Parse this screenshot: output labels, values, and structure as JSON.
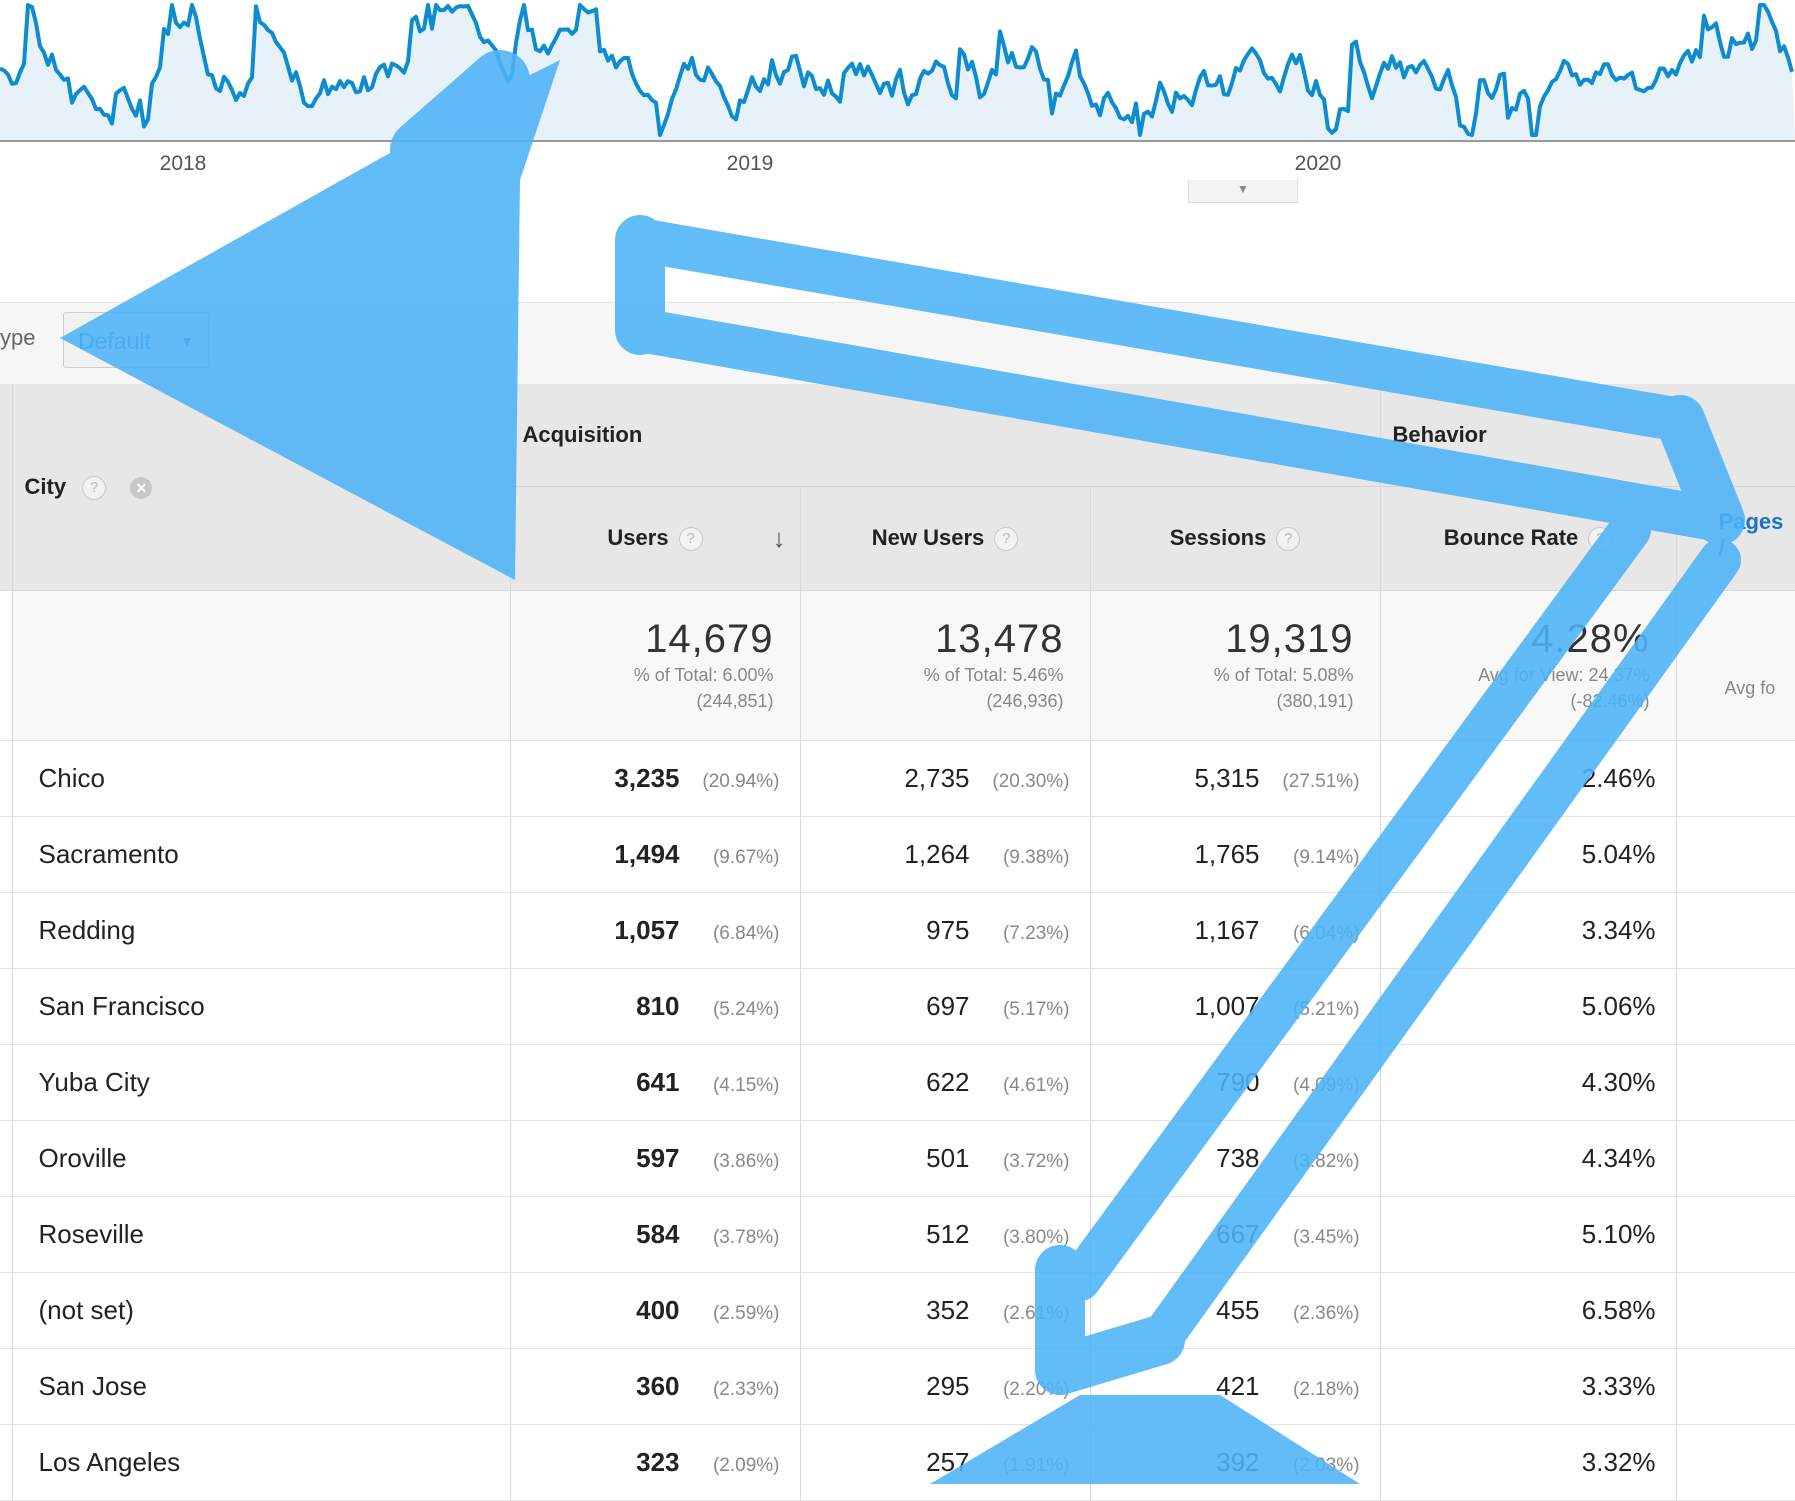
{
  "timeline": {
    "years": [
      "2018",
      "2019",
      "2020"
    ],
    "line_color": "#0d8ccf",
    "fill_color": "#e6f1fa"
  },
  "toolbar": {
    "type_label": "ype",
    "type_value": "Default"
  },
  "table": {
    "groups": {
      "acquisition": "Acquisition",
      "behavior": "Behavior"
    },
    "city_header": "City",
    "columns": {
      "users": "Users",
      "new_users": "New Users",
      "sessions": "Sessions",
      "bounce_rate": "Bounce Rate",
      "pages": "Pages /"
    },
    "totals": {
      "users": {
        "value": "14,679",
        "line1": "% of Total: 6.00%",
        "line2": "(244,851)"
      },
      "new_users": {
        "value": "13,478",
        "line1": "% of Total: 5.46%",
        "line2": "(246,936)"
      },
      "sessions": {
        "value": "19,319",
        "line1": "% of Total: 5.08%",
        "line2": "(380,191)"
      },
      "bounce_rate": {
        "value": "4.28%",
        "line1": "Avg for View: 24.37%",
        "line2": "(-82.46%)"
      },
      "pages": {
        "line1": "Avg fo"
      }
    },
    "rows": [
      {
        "city": "Chico",
        "users": "3,235",
        "users_pct": "(20.94%)",
        "new_users": "2,735",
        "new_users_pct": "(20.30%)",
        "sessions": "5,315",
        "sessions_pct": "(27.51%)",
        "bounce": "2.46%"
      },
      {
        "city": "Sacramento",
        "users": "1,494",
        "users_pct": "(9.67%)",
        "new_users": "1,264",
        "new_users_pct": "(9.38%)",
        "sessions": "1,765",
        "sessions_pct": "(9.14%)",
        "bounce": "5.04%"
      },
      {
        "city": "Redding",
        "users": "1,057",
        "users_pct": "(6.84%)",
        "new_users": "975",
        "new_users_pct": "(7.23%)",
        "sessions": "1,167",
        "sessions_pct": "(6.04%)",
        "bounce": "3.34%"
      },
      {
        "city": "San Francisco",
        "users": "810",
        "users_pct": "(5.24%)",
        "new_users": "697",
        "new_users_pct": "(5.17%)",
        "sessions": "1,007",
        "sessions_pct": "(5.21%)",
        "bounce": "5.06%"
      },
      {
        "city": "Yuba City",
        "users": "641",
        "users_pct": "(4.15%)",
        "new_users": "622",
        "new_users_pct": "(4.61%)",
        "sessions": "790",
        "sessions_pct": "(4.09%)",
        "bounce": "4.30%"
      },
      {
        "city": "Oroville",
        "users": "597",
        "users_pct": "(3.86%)",
        "new_users": "501",
        "new_users_pct": "(3.72%)",
        "sessions": "738",
        "sessions_pct": "(3.82%)",
        "bounce": "4.34%"
      },
      {
        "city": "Roseville",
        "users": "584",
        "users_pct": "(3.78%)",
        "new_users": "512",
        "new_users_pct": "(3.80%)",
        "sessions": "667",
        "sessions_pct": "(3.45%)",
        "bounce": "5.10%"
      },
      {
        "city": "(not set)",
        "users": "400",
        "users_pct": "(2.59%)",
        "new_users": "352",
        "new_users_pct": "(2.61%)",
        "sessions": "455",
        "sessions_pct": "(2.36%)",
        "bounce": "6.58%"
      },
      {
        "city": "San Jose",
        "users": "360",
        "users_pct": "(2.33%)",
        "new_users": "295",
        "new_users_pct": "(2.20%)",
        "sessions": "421",
        "sessions_pct": "(2.18%)",
        "bounce": "3.33%"
      },
      {
        "city": "Los Angeles",
        "users": "323",
        "users_pct": "(2.09%)",
        "new_users": "257",
        "new_users_pct": "(1.91%)",
        "sessions": "392",
        "sessions_pct": "(2.03%)",
        "bounce": "3.32%"
      }
    ]
  },
  "overlay": {
    "arrow_color": "#4db3f7"
  }
}
